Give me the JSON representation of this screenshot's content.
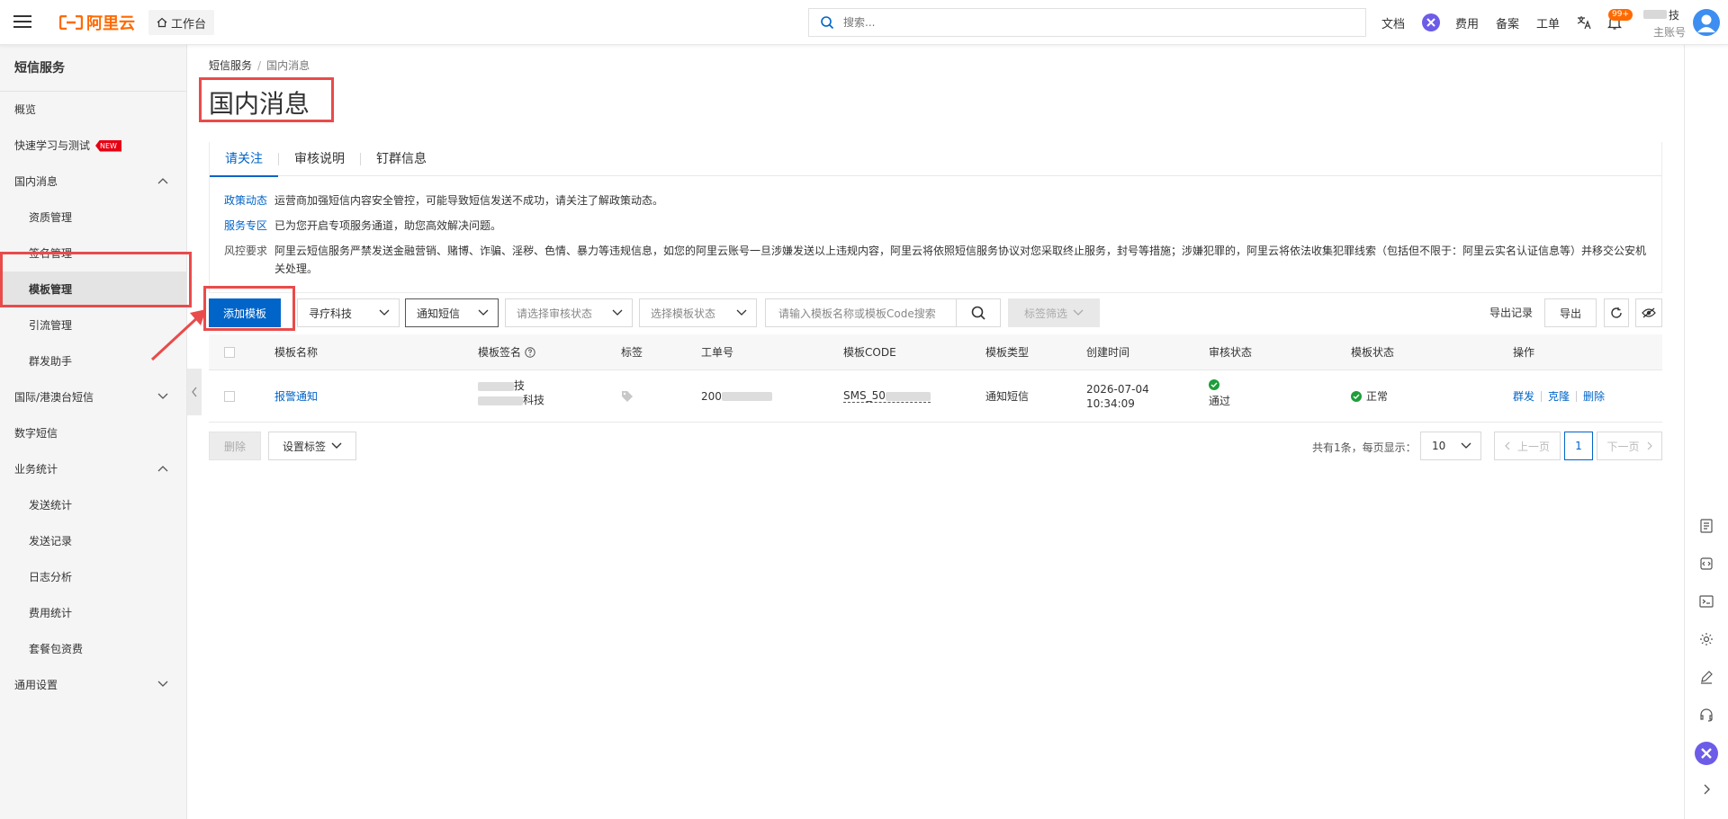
{
  "topbar": {
    "logo_text": "阿里云",
    "home_label": "工作台",
    "search_placeholder": "搜索...",
    "nav": [
      "文档",
      "费用",
      "备案",
      "工单"
    ],
    "notification_count": "99+",
    "user_name_suffix": "技",
    "user_role": "主账号",
    "brand_color": "#ff6a00"
  },
  "sidebar": {
    "title": "短信服务",
    "items": [
      {
        "label": "概览"
      },
      {
        "label": "快速学习与测试",
        "badge": "NEW"
      },
      {
        "label": "国内消息",
        "expandable": true,
        "expanded": true
      },
      {
        "label": "资质管理",
        "sub": true
      },
      {
        "label": "签名管理",
        "sub": true
      },
      {
        "label": "模板管理",
        "sub": true,
        "active": true
      },
      {
        "label": "引流管理",
        "sub": true
      },
      {
        "label": "群发助手",
        "sub": true
      },
      {
        "label": "国际/港澳台短信",
        "expandable": true,
        "expanded": false
      },
      {
        "label": "数字短信"
      },
      {
        "label": "业务统计",
        "expandable": true,
        "expanded": true
      },
      {
        "label": "发送统计",
        "sub": true
      },
      {
        "label": "发送记录",
        "sub": true
      },
      {
        "label": "日志分析",
        "sub": true
      },
      {
        "label": "费用统计",
        "sub": true
      },
      {
        "label": "套餐包资费",
        "sub": true
      },
      {
        "label": "通用设置",
        "expandable": true,
        "expanded": false
      }
    ]
  },
  "breadcrumb": {
    "root": "短信服务",
    "sep": "/",
    "current": "国内消息"
  },
  "page_title": "国内消息",
  "notice": {
    "tabs": [
      "请关注",
      "审核说明",
      "钉群信息"
    ],
    "active_tab": 0,
    "rows": [
      {
        "label": "政策动态",
        "text": "运营商加强短信内容安全管控，可能导致短信发送不成功，请关注了解政策动态。"
      },
      {
        "label": "服务专区",
        "text": "已为您开启专项服务通道，助您高效解决问题。"
      },
      {
        "label": "风控要求",
        "text": "阿里云短信服务严禁发送金融营销、赌博、诈骗、淫秽、色情、暴力等违规信息，如您的阿里云账号一旦涉嫌发送以上违规内容，阿里云将依照短信服务协议对您采取终止服务，封号等措施；涉嫌犯罪的，阿里云将依法收集犯罪线索（包括但不限于：阿里云实名认证信息等）并移交公安机关处理。"
      }
    ]
  },
  "toolbar": {
    "add_button": "添加模板",
    "sign_filter": "寻疗科技",
    "type_filter": "通知短信",
    "audit_status_placeholder": "请选择审核状态",
    "template_status_placeholder": "选择模板状态",
    "search_placeholder": "请输入模板名称或模板Code搜索",
    "tag_filter": "标签筛选",
    "export_records": "导出记录",
    "export_button": "导出"
  },
  "table": {
    "columns": [
      "模板名称",
      "模板签名",
      "标签",
      "工单号",
      "模板CODE",
      "模板类型",
      "创建时间",
      "审核状态",
      "模板状态",
      "操作"
    ],
    "rows": [
      {
        "name": "报警通知",
        "sign_line1_suffix": "技",
        "sign_line2_suffix": "科技",
        "ticket": "200",
        "code": "SMS_50",
        "type": "通知短信",
        "created_date": "2026-07-04",
        "created_time": "10:34:09",
        "audit_status": "通过",
        "template_status": "正常",
        "actions": [
          "群发",
          "克隆",
          "删除"
        ]
      }
    ]
  },
  "footer": {
    "delete_button": "删除",
    "set_tag_button": "设置标签",
    "total_text": "共有1条，每页显示：",
    "page_size": "10",
    "prev": "上一页",
    "current_page": "1",
    "next": "下一页"
  },
  "colors": {
    "primary": "#0064c8",
    "success": "#1e9e3a",
    "highlight": "#e94b4b"
  }
}
